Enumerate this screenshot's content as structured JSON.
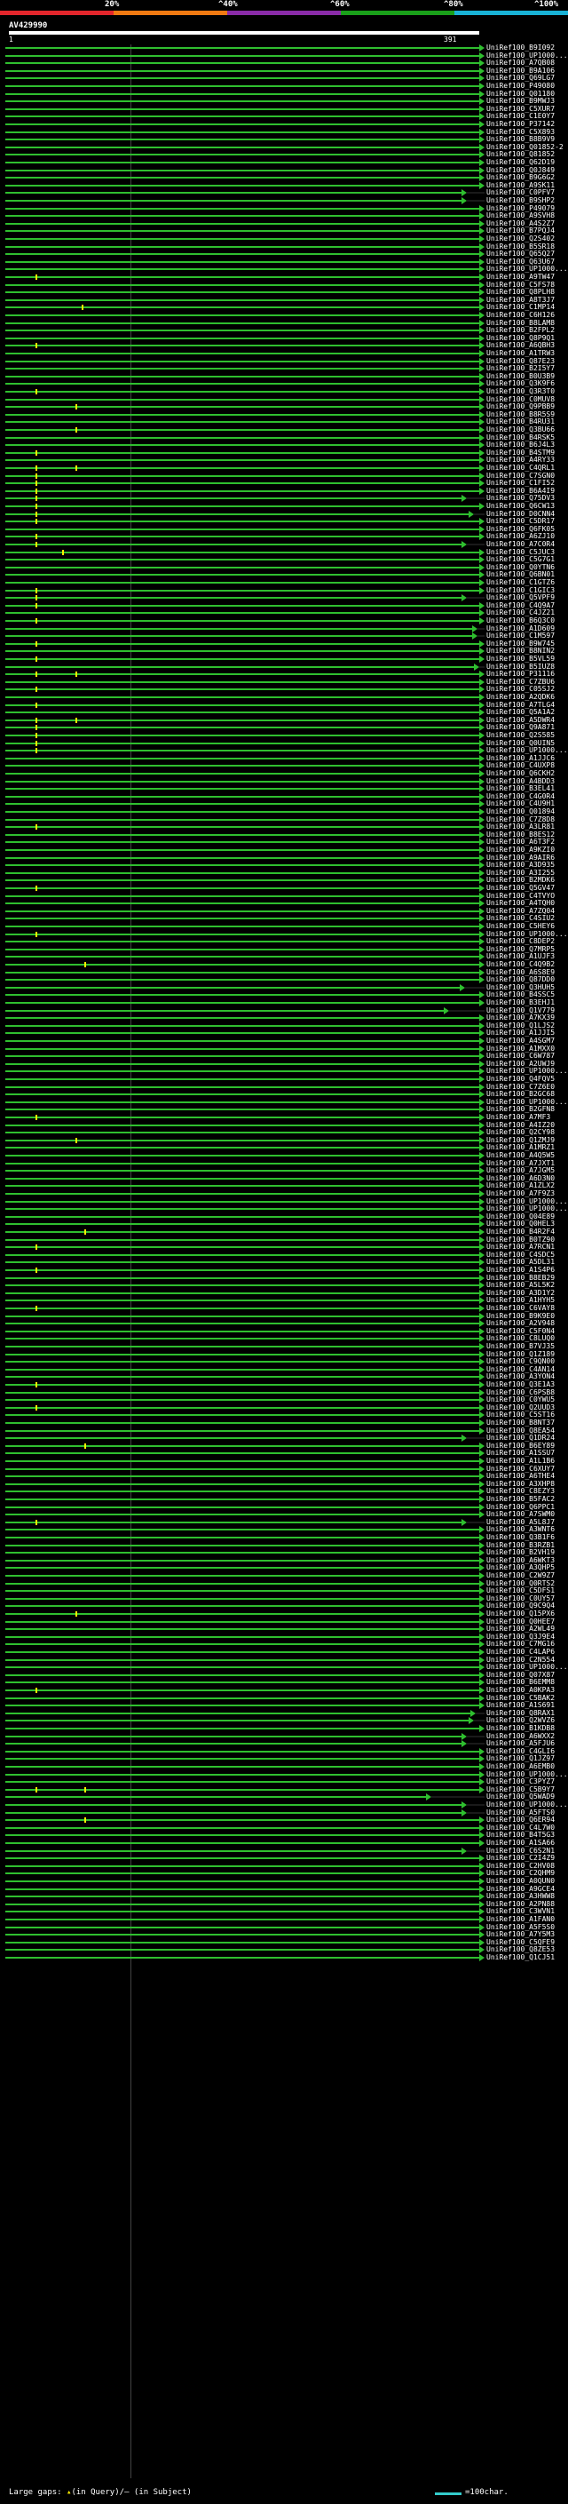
{
  "scale": {
    "labels": [
      "20%",
      "^40%",
      "^60%",
      "^80%",
      "^100%"
    ],
    "colors": [
      "#e3262c",
      "#f07a12",
      "#8a2ba8",
      "#1aa01a",
      "#19b2d6"
    ]
  },
  "query": {
    "title": "AV429990",
    "start": "1",
    "end": "391"
  },
  "hits": [
    "UniRef100_B9I092",
    "UniRef100_UP1000...",
    "UniRef100_A7QB08",
    "UniRef100_B9A106",
    "UniRef100_Q69LG7",
    "UniRef100_P49080",
    "UniRef100_Q01180",
    "UniRef100_B9MWJ3",
    "UniRef100_C5XUR7",
    "UniRef100_C1E0Y7",
    "UniRef100_P37142",
    "UniRef100_C5X893",
    "UniRef100_B8B9V9",
    "UniRef100_Q01852-2",
    "UniRef100_Q81852",
    "UniRef100_Q62D19",
    "UniRef100_Q0J849",
    "UniRef100_B9G6G2",
    "UniRef100_A9SK11",
    "UniRef100_C0PFV7",
    "UniRef100_B9SHP2",
    "UniRef100_P49079",
    "UniRef100_A9SVH8",
    "UniRef100_A4S2Z7",
    "UniRef100_B7PQJ4",
    "UniRef100_Q2S402",
    "UniRef100_B5SR18",
    "UniRef100_Q65Q27",
    "UniRef100_Q63U67",
    "UniRef100_UP1000...",
    "UniRef100_A9TW47",
    "UniRef100_C5FS78",
    "UniRef100_Q8PLH8",
    "UniRef100_A8T3J7",
    "UniRef100_C1MP14",
    "UniRef100_C6H126",
    "UniRef100_B8LAM8",
    "UniRef100_B2FPL2",
    "UniRef100_Q8P9Q1",
    "UniRef100_A6QBH3",
    "UniRef100_A1TRW3",
    "UniRef100_Q87E23",
    "UniRef100_B2I5Y7",
    "UniRef100_B0U3B9",
    "UniRef100_Q3K9F6",
    "UniRef100_Q3R3T0",
    "UniRef100_C0MUV8",
    "UniRef100_Q9PBB9",
    "UniRef100_B8R5S9",
    "UniRef100_B4RU31",
    "UniRef100_Q3BU66",
    "UniRef100_B4RSK5",
    "UniRef100_B6J4L3",
    "UniRef100_B4STM9",
    "UniRef100_A4RY33",
    "UniRef100_C4QRL1",
    "UniRef100_C7SGN0",
    "UniRef100_C1FI52",
    "UniRef100_B6A4I9",
    "UniRef100_Q75DV3",
    "UniRef100_Q6CW13",
    "UniRef100_D0CNN4",
    "UniRef100_C5DR17",
    "UniRef100_Q6FK05",
    "UniRef100_A6ZJ10",
    "UniRef100_A7C0R4",
    "UniRef100_C5JUC3",
    "UniRef100_C5G7G1",
    "UniRef100_Q0YTN6",
    "UniRef100_Q6BN01",
    "UniRef100_C1GTZ6",
    "UniRef100_C1GIC3",
    "UniRef100_Q5VPF9",
    "UniRef100_C4Q9A7",
    "UniRef100_C4JZ21",
    "UniRef100_B6Q3C0",
    "UniRef100_A1D609",
    "UniRef100_C1M597",
    "UniRef100_B9W745",
    "UniRef100_B8NIN2",
    "UniRef100_B5VL59",
    "UniRef100_B5IUZ8",
    "UniRef100_P31116",
    "UniRef100_C7ZBU6",
    "UniRef100_C05SJ2",
    "UniRef100_A2QDK6",
    "UniRef100_A7TLG4",
    "UniRef100_Q5A1A2",
    "UniRef100_A5DWR4",
    "UniRef100_Q9A871",
    "UniRef100_Q2S585",
    "UniRef100_Q0UIN5",
    "UniRef100_UP1000...",
    "UniRef100_A1JJC6",
    "UniRef100_C4UXP8",
    "UniRef100_Q6CKH2",
    "UniRef100_A4BDD3",
    "UniRef100_B3EL41",
    "UniRef100_C4G0R4",
    "UniRef100_C4U9H1",
    "UniRef100_Q01894",
    "UniRef100_C7Z8D8",
    "UniRef100_A3LR81",
    "UniRef100_B8ES12",
    "UniRef100_A6T3F2",
    "UniRef100_A9KZI0",
    "UniRef100_A9AIR6",
    "UniRef100_A3D935",
    "UniRef100_A3I255",
    "UniRef100_B2MDK6",
    "UniRef100_Q5GV47",
    "UniRef100_C4TVYO",
    "UniRef100_A4TQH0",
    "UniRef100_A7ZQ04",
    "UniRef100_C4SIU2",
    "UniRef100_C5HEY6",
    "UniRef100_UP1000...",
    "UniRef100_C8DEP2",
    "UniRef100_Q7MRP5",
    "UniRef100_A1UJF3",
    "UniRef100_C4Q9B2",
    "UniRef100_A6S8E9",
    "UniRef100_Q87DD0",
    "UniRef100_Q3HUH5",
    "UniRef100_B4SSC5",
    "UniRef100_B3EHJ1",
    "UniRef100_Q1V779",
    "UniRef100_A7KX39",
    "UniRef100_Q1LJS2",
    "UniRef100_A1JJI5",
    "UniRef100_A4SGM7",
    "UniRef100_A1MXX0",
    "UniRef100_C6W787",
    "UniRef100_A2UWJ9",
    "UniRef100_UP1000...",
    "UniRef100_Q4FQV5",
    "UniRef100_C7Z6E0",
    "UniRef100_B2GC68",
    "UniRef100_UP1000...",
    "UniRef100_B2GFN8",
    "UniRef100_A7MF3",
    "UniRef100_A4IZ20",
    "UniRef100_Q2CY98",
    "UniRef100_Q1ZMJ9",
    "UniRef100_A1MRZ1",
    "UniRef100_A4Q5W5",
    "UniRef100_A7JXT1",
    "UniRef100_A7JGM5",
    "UniRef100_A6D3N0",
    "UniRef100_A1ZLX2",
    "UniRef100_A7F9Z3",
    "UniRef100_UP1000...",
    "UniRef100_UP1000...",
    "UniRef100_Q04E89",
    "UniRef100_Q0HEL3",
    "UniRef100_B4R2F4",
    "UniRef100_B0TZ90",
    "UniRef100_A7RCN1",
    "UniRef100_C4SDC5",
    "UniRef100_A5DL31",
    "UniRef100_A1S4P6",
    "UniRef100_B8EB29",
    "UniRef100_A5L5K2",
    "UniRef100_A3D1Y2",
    "UniRef100_A1HYH5",
    "UniRef100_C6VAY8",
    "UniRef100_B9K9E0",
    "UniRef100_A2V948",
    "UniRef100_C5F0N4",
    "UniRef100_C8LUQ0",
    "UniRef100_B7VJ35",
    "UniRef100_Q1Z189",
    "UniRef100_C9QN00",
    "UniRef100_C4AN14",
    "UniRef100_A3YON4",
    "UniRef100_Q3E1A3",
    "UniRef100_C6PSB8",
    "UniRef100_C0YWU5",
    "UniRef100_Q2UUD3",
    "UniRef100_C5ST16",
    "UniRef100_B8NT37",
    "UniRef100_Q8EA54",
    "UniRef100_Q1DR24",
    "UniRef100_B6EY89",
    "UniRef100_A1SSU7",
    "UniRef100_A1L1B6",
    "UniRef100_C6XUY7",
    "UniRef100_A6THE4",
    "UniRef100_A3XHP8",
    "UniRef100_C8EZY3",
    "UniRef100_B5FAC2",
    "UniRef100_Q6PPC1",
    "UniRef100_A7SWM0",
    "UniRef100_A5L8J7",
    "UniRef100_A3WNT6",
    "UniRef100_Q3B1F6",
    "UniRef100_B3RZB1",
    "UniRef100_B2VH19",
    "UniRef100_A6WKT3",
    "UniRef100_A3QHP5",
    "UniRef100_C2W9Z7",
    "UniRef100_Q0RTS2",
    "UniRef100_C5DFS1",
    "UniRef100_C0UY57",
    "UniRef100_Q9C9Q4",
    "UniRef100_Q15PX6",
    "UniRef100_Q0HEE7",
    "UniRef100_A2WL49",
    "UniRef100_Q3J9E4",
    "UniRef100_C7MG16",
    "UniRef100_C4LAP6",
    "UniRef100_C2N554",
    "UniRef100_UP1000...",
    "UniRef100_Q07X87",
    "UniRef100_B6EMM8",
    "UniRef100_A0KPA3",
    "UniRef100_C5BAK2",
    "UniRef100_A1S691",
    "UniRef100_Q8RAX1",
    "UniRef100_Q2WVZ6",
    "UniRef100_B1KDB8",
    "UniRef100_A6WXX2",
    "UniRef100_A5FJU6",
    "UniRef100_C4GLI6",
    "UniRef100_Q1JZ97",
    "UniRef100_A6EMB0",
    "UniRef100_UP1000...",
    "UniRef100_C3PYZ7",
    "UniRef100_C5B9Y7",
    "UniRef100_Q5WAD9",
    "UniRef100_UP1000...",
    "UniRef100_A5FTS0",
    "UniRef100_Q6ER94",
    "UniRef100_C4L7W0",
    "UniRef100_B4T5G3",
    "UniRef100_A1SA66",
    "UniRef100_C6S2N1",
    "UniRef100_C2I4Z9",
    "UniRef100_C2HV08",
    "UniRef100_C2QHM9",
    "UniRef100_A0QUN0",
    "UniRef100_A9GCE4",
    "UniRef100_A3HWW8",
    "UniRef100_A2PN88",
    "UniRef100_C3WVN1",
    "UniRef100_A1FAN0",
    "UniRef100_A5F5S0",
    "UniRef100_A7Y5M3",
    "UniRef100_C5QFE9",
    "UniRef100_Q8ZE53",
    "UniRef100_Q1CJ51"
  ],
  "footer": {
    "prefix": "Large gaps: ",
    "query_glyph": "▴",
    "query_text": "(in Query)/",
    "subject_glyph": "—",
    "subject_text": " (in Subject)",
    "legend_text": "=100char."
  }
}
